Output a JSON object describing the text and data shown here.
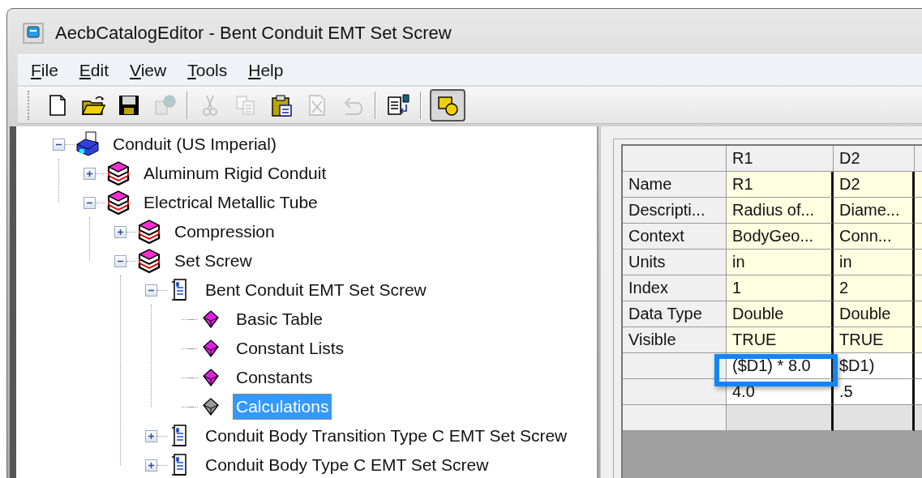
{
  "window": {
    "title": "AecbCatalogEditor - Bent Conduit EMT Set Screw"
  },
  "menu": [
    "File",
    "Edit",
    "View",
    "Tools",
    "Help"
  ],
  "toolbar": [
    {
      "kind": "button",
      "disabled": false
    },
    {
      "kind": "button",
      "disabled": false
    },
    {
      "kind": "button",
      "disabled": false
    },
    {
      "kind": "button",
      "disabled": true
    },
    {
      "kind": "separator"
    },
    {
      "kind": "button",
      "disabled": true
    },
    {
      "kind": "button",
      "disabled": true
    },
    {
      "kind": "button",
      "disabled": false
    },
    {
      "kind": "button",
      "disabled": true
    },
    {
      "kind": "button",
      "disabled": true
    },
    {
      "kind": "separator"
    },
    {
      "kind": "button",
      "disabled": false
    },
    {
      "kind": "separator"
    },
    {
      "kind": "toggle",
      "pressed": true
    }
  ],
  "tree": [
    {
      "label": "Conduit (US Imperial)",
      "kind": "catalog",
      "expanded": true,
      "selected": false,
      "children": [
        {
          "label": "Aluminum Rigid Conduit",
          "kind": "chapter",
          "expanded": false,
          "selected": false
        },
        {
          "label": "Electrical Metallic Tube",
          "kind": "chapter",
          "expanded": true,
          "selected": false,
          "children": [
            {
              "label": "Compression",
              "kind": "chapter",
              "expanded": false,
              "selected": false
            },
            {
              "label": "Set Screw",
              "kind": "chapter",
              "expanded": true,
              "selected": false,
              "children": [
                {
                  "label": "Bent Conduit EMT Set Screw",
                  "kind": "part",
                  "expanded": true,
                  "selected": false,
                  "children": [
                    {
                      "label": "Basic Table",
                      "kind": "table",
                      "selected": false
                    },
                    {
                      "label": "Constant Lists",
                      "kind": "table",
                      "selected": false
                    },
                    {
                      "label": "Constants",
                      "kind": "table",
                      "selected": false
                    },
                    {
                      "label": "Calculations",
                      "kind": "table",
                      "selected": true
                    }
                  ]
                },
                {
                  "label": "Conduit Body Transition Type C EMT Set Screw",
                  "kind": "part",
                  "expanded": false,
                  "selected": false
                },
                {
                  "label": "Conduit Body Type C EMT Set Screw",
                  "kind": "part",
                  "expanded": false,
                  "selected": false
                }
              ]
            }
          ]
        }
      ]
    }
  ],
  "grid": {
    "columns": [
      "R1",
      "D2"
    ],
    "rows": [
      {
        "kind": "property",
        "label": "Name",
        "cells": [
          "R1",
          "D2"
        ]
      },
      {
        "kind": "property",
        "label": "Descripti...",
        "cells": [
          "Radius of...",
          "Diame..."
        ]
      },
      {
        "kind": "property",
        "label": "Context",
        "cells": [
          "BodyGeo...",
          "Conn..."
        ]
      },
      {
        "kind": "property",
        "label": "Units",
        "cells": [
          "in",
          "in"
        ]
      },
      {
        "kind": "property",
        "label": "Index",
        "cells": [
          "1",
          "2"
        ]
      },
      {
        "kind": "property",
        "label": "Data Type",
        "cells": [
          "Double",
          "Double"
        ]
      },
      {
        "kind": "property",
        "label": "Visible",
        "cells": [
          "TRUE",
          "TRUE"
        ]
      },
      {
        "kind": "value",
        "cells": [
          "($D1) * 8.0",
          "$D1)"
        ]
      },
      {
        "kind": "value",
        "cells": [
          "4.0",
          ".5"
        ]
      },
      {
        "kind": "blank"
      }
    ]
  },
  "highlight": {
    "shown": true
  }
}
